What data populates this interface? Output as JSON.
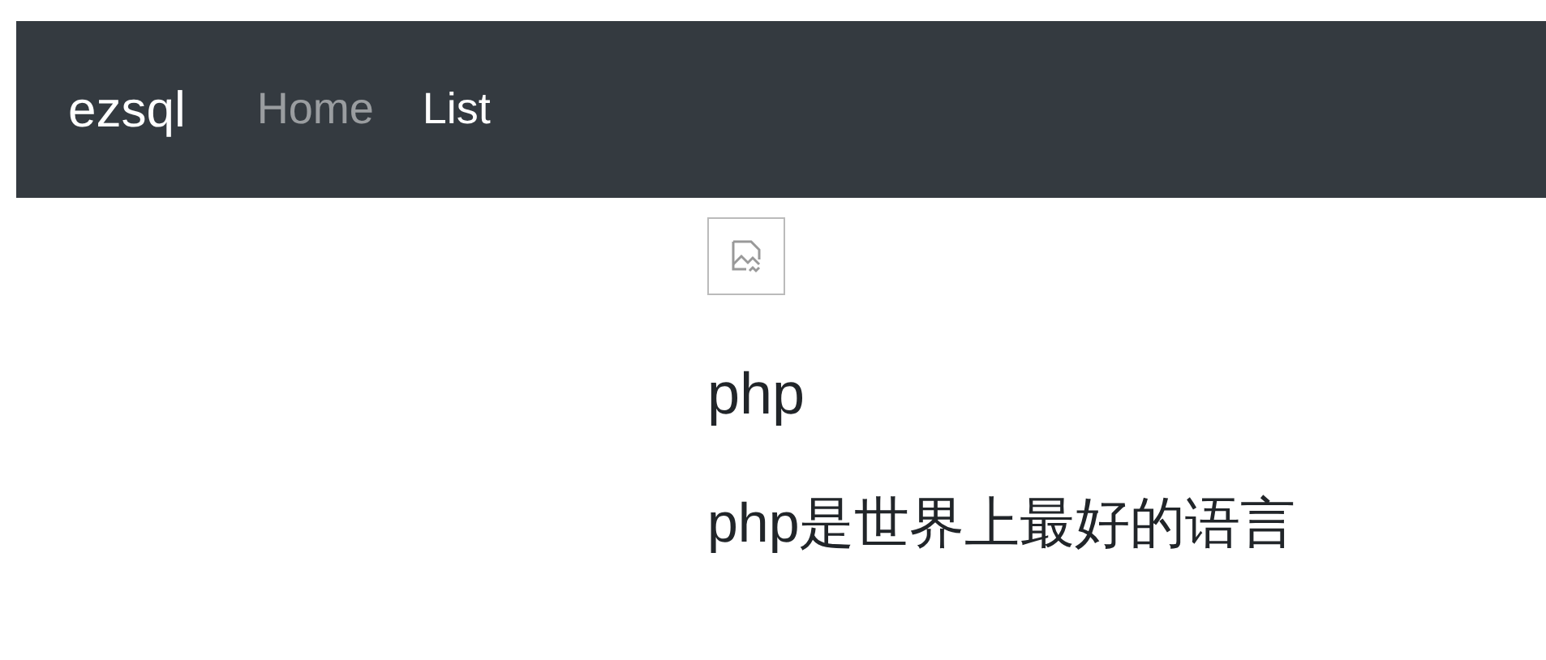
{
  "navbar": {
    "brand": "ezsql",
    "links": [
      {
        "label": "Home",
        "selected": false
      },
      {
        "label": "List",
        "selected": true
      }
    ]
  },
  "post": {
    "image": {
      "kind": "broken"
    },
    "title": "php",
    "body": "php是世界上最好的语言"
  }
}
